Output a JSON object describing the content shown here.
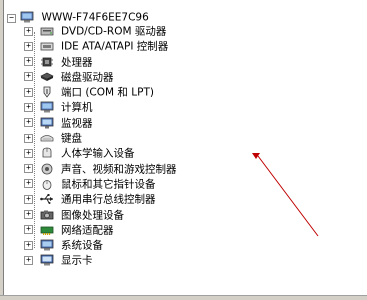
{
  "tree": {
    "root": {
      "label": "WWW-F74F6EE7C96",
      "icon": "computer-icon",
      "expanded": true
    },
    "items": [
      {
        "label": "DVD/CD-ROM 驱动器",
        "icon": "cdrom-icon"
      },
      {
        "label": "IDE ATA/ATAPI 控制器",
        "icon": "ide-controller-icon"
      },
      {
        "label": "处理器",
        "icon": "processor-icon"
      },
      {
        "label": "磁盘驱动器",
        "icon": "disk-drive-icon"
      },
      {
        "label": "端口 (COM 和 LPT)",
        "icon": "port-icon"
      },
      {
        "label": "计算机",
        "icon": "computer-icon"
      },
      {
        "label": "监视器",
        "icon": "monitor-icon"
      },
      {
        "label": "键盘",
        "icon": "keyboard-icon"
      },
      {
        "label": "人体学输入设备",
        "icon": "hid-icon"
      },
      {
        "label": "声音、视频和游戏控制器",
        "icon": "sound-icon"
      },
      {
        "label": "鼠标和其它指针设备",
        "icon": "mouse-icon"
      },
      {
        "label": "通用串行总线控制器",
        "icon": "usb-icon"
      },
      {
        "label": "图像处理设备",
        "icon": "imaging-icon"
      },
      {
        "label": "网络适配器",
        "icon": "network-adapter-icon"
      },
      {
        "label": "系统设备",
        "icon": "system-device-icon"
      },
      {
        "label": "显示卡",
        "icon": "display-adapter-icon"
      }
    ]
  },
  "colors": {
    "annotation_line": "#c00000",
    "background": "#ffffff"
  }
}
